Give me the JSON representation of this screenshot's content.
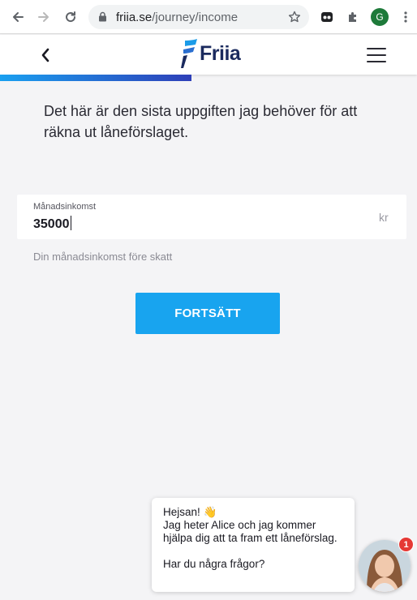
{
  "browser": {
    "url_host": "friia.se",
    "url_path": "/journey/income",
    "profile_initial": "G"
  },
  "header": {
    "logo_text": "Friia",
    "icons": [
      "chevron-left-icon",
      "menu-icon"
    ]
  },
  "progress": {
    "fraction": 0.46,
    "color_start": "#1aa0f0",
    "color_end": "#2e3fb8"
  },
  "main": {
    "intro": "Det här är den sista uppgiften jag behöver för att räkna ut låneförslaget.",
    "income_field": {
      "label": "Månadsinkomst",
      "value": "35000",
      "unit": "kr"
    },
    "helper": "Din månadsinkomst före skatt",
    "cta_label": "FORTSÄTT"
  },
  "chat": {
    "greeting": "Hejsan! 👋",
    "line1": "Jag heter Alice och jag kommer hjälpa dig att ta fram ett låneförslag.",
    "question": "Har du några frågor?",
    "badge_count": "1"
  },
  "colors": {
    "accent": "#18a4ef",
    "brand_dark": "#1a2a5e",
    "badge": "#e53935"
  }
}
